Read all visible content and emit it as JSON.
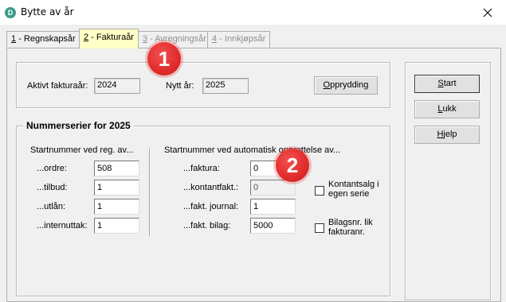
{
  "window": {
    "title": "Bytte av år",
    "icon_letter": "D"
  },
  "tabs": [
    {
      "num": "1",
      "label": " - Regnskapsår"
    },
    {
      "num": "2",
      "label": " - Fakturaår"
    },
    {
      "num": "3",
      "label": " - Avregningsår"
    },
    {
      "num": "4",
      "label": " - Innkjøpsår"
    }
  ],
  "top_group": {
    "active_label": "Aktivt fakturaår:",
    "active_value": "2024",
    "new_label": "Nytt år:",
    "new_value": "2025",
    "cleanup_label_u": "O",
    "cleanup_label_rest": "pprydding"
  },
  "series_group": {
    "title": "Nummerserier for 2025",
    "left_header": "Startnummer ved reg. av...",
    "left_fields": [
      {
        "label": "...ordre:",
        "value": "508"
      },
      {
        "label": "...tilbud:",
        "value": "1"
      },
      {
        "label": "...utlån:",
        "value": "1"
      },
      {
        "label": "...internuttak:",
        "value": "1"
      }
    ],
    "right_header": "Startnummer ved automatisk opprettelse av...",
    "right_fields": [
      {
        "label": "...faktura:",
        "value": "0"
      },
      {
        "label": "...kontantfakt.:",
        "value": "0"
      },
      {
        "label": "...fakt. journal:",
        "value": "1"
      },
      {
        "label": "...fakt. bilag:",
        "value": "5000"
      }
    ],
    "check1_line1": "Kontantsalg i",
    "check1_line2": "egen serie",
    "check2_line1": "Bilagsnr. lik",
    "check2_line2": "fakturanr."
  },
  "buttons": {
    "start_u": "S",
    "start_rest": "tart",
    "close_u": "L",
    "close_rest": "ukk",
    "help_u": "H",
    "help_rest": "jelp"
  },
  "annotations": {
    "badge1": "1",
    "badge2": "2"
  }
}
